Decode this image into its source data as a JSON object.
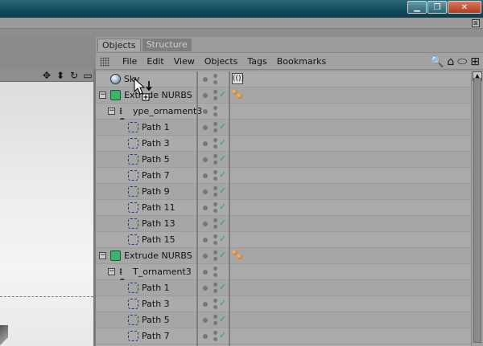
{
  "window": {
    "minimize_glyph": "▁",
    "restore_glyph": "❐",
    "close_glyph": "✕"
  },
  "app": {
    "corner_glyph": "⊠"
  },
  "viewport": {
    "header_icons": [
      "move-icon",
      "zoom-icon",
      "rotate-icon",
      "maximize-icon"
    ],
    "header_glyphs": [
      "✥",
      "⬍",
      "↻",
      "▭"
    ]
  },
  "panel": {
    "tabs": [
      {
        "label": "Objects",
        "active": true
      },
      {
        "label": "Structure",
        "active": false
      }
    ],
    "menu": [
      "File",
      "Edit",
      "View",
      "Objects",
      "Tags",
      "Bookmarks"
    ],
    "toolbar_icons": {
      "search": "🔍",
      "home": "⌂",
      "eye": "⬭",
      "add": "⊞"
    }
  },
  "tree": {
    "rows": [
      {
        "name": "Sky",
        "type": "sky",
        "depth": 0,
        "expander": "",
        "checked": false,
        "tag": "sky-tag"
      },
      {
        "name": "Extrude NURBS",
        "type": "nurbs",
        "depth": 0,
        "expander": "−",
        "checked": true,
        "tag": "phong"
      },
      {
        "name": "ype_ornament3",
        "type": "null",
        "depth": 1,
        "expander": "−",
        "checked": false,
        "tag": ""
      },
      {
        "name": "Path 1",
        "type": "spline",
        "depth": 2,
        "expander": "",
        "checked": true,
        "tag": ""
      },
      {
        "name": "Path 3",
        "type": "spline",
        "depth": 2,
        "expander": "",
        "checked": true,
        "tag": ""
      },
      {
        "name": "Path 5",
        "type": "spline",
        "depth": 2,
        "expander": "",
        "checked": true,
        "tag": ""
      },
      {
        "name": "Path 7",
        "type": "spline",
        "depth": 2,
        "expander": "",
        "checked": true,
        "tag": ""
      },
      {
        "name": "Path 9",
        "type": "spline",
        "depth": 2,
        "expander": "",
        "checked": true,
        "tag": ""
      },
      {
        "name": "Path 11",
        "type": "spline",
        "depth": 2,
        "expander": "",
        "checked": true,
        "tag": ""
      },
      {
        "name": "Path 13",
        "type": "spline",
        "depth": 2,
        "expander": "",
        "checked": true,
        "tag": ""
      },
      {
        "name": "Path 15",
        "type": "spline",
        "depth": 2,
        "expander": "",
        "checked": true,
        "tag": ""
      },
      {
        "name": "Extrude NURBS",
        "type": "nurbs",
        "depth": 0,
        "expander": "−",
        "checked": true,
        "tag": "phong"
      },
      {
        "name": "T_ornament3",
        "type": "null",
        "depth": 1,
        "expander": "−",
        "checked": false,
        "tag": ""
      },
      {
        "name": "Path 1",
        "type": "spline",
        "depth": 2,
        "expander": "",
        "checked": true,
        "tag": ""
      },
      {
        "name": "Path 3",
        "type": "spline",
        "depth": 2,
        "expander": "",
        "checked": true,
        "tag": ""
      },
      {
        "name": "Path 5",
        "type": "spline",
        "depth": 2,
        "expander": "",
        "checked": true,
        "tag": ""
      },
      {
        "name": "Path 7",
        "type": "spline",
        "depth": 2,
        "expander": "",
        "checked": true,
        "tag": ""
      }
    ],
    "check_glyph": "✓",
    "null_glyph": "⁞0",
    "sky_tag_glyph": "(())"
  },
  "scrollbar": {
    "up_glyph": "▲"
  },
  "colors": {
    "titlebar": "#124a5a",
    "panel_bg": "#a9a9a9",
    "check_green": "#23a84a"
  }
}
